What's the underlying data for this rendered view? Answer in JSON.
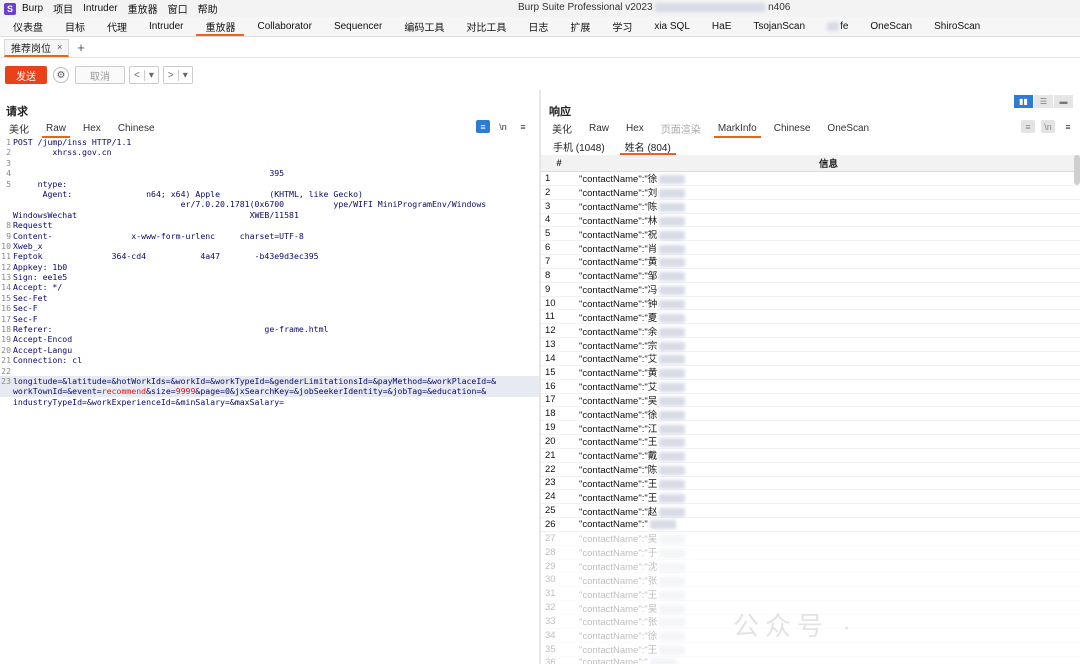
{
  "titlebar": {
    "menus": [
      "Burp",
      "项目",
      "Intruder",
      "重放器",
      "窗口",
      "帮助"
    ],
    "window_title_start": "Burp Suite Professional v2023",
    "window_title_end": "n406"
  },
  "tool_tabs": [
    "仪表盘",
    "目标",
    "代理",
    "Intruder",
    "重放器",
    "Collaborator",
    "Sequencer",
    "编码工具",
    "对比工具",
    "日志",
    "扩展",
    "学习",
    "xia SQL",
    "HaE",
    "TsojanScan",
    "fe",
    "OneScan",
    "ShiroScan"
  ],
  "active_tool_tab": 4,
  "subtab": {
    "label": "推荐岗位",
    "close": "×",
    "add": "+"
  },
  "toolbar": {
    "send": "发送",
    "cancel": "取消",
    "prev": "<",
    "next": ">",
    "dropdown": "▾"
  },
  "request": {
    "title": "请求",
    "tabs": [
      "美化",
      "Raw",
      "Hex",
      "Chinese"
    ],
    "active_tab": 1,
    "icon_newline": "\\n",
    "icon_menu": "≡",
    "lines": [
      {
        "n": "1",
        "t": "POST /jump/inss HTTP/1.1"
      },
      {
        "n": "2",
        "t": "        xhrss.gov.cn"
      },
      {
        "n": "3",
        "t": ""
      },
      {
        "n": "4",
        "t": "                                                    395"
      },
      {
        "n": "5",
        "t": "     ntype:"
      },
      {
        "n": "",
        "t": "      Agent:               n64; x64) Apple          (KHTML, like Gecko)"
      },
      {
        "n": "",
        "t": "                                  er/7.0.20.1781(0x6700          ype/WIFI MiniProgramEnv/Windows"
      },
      {
        "n": "",
        "t": "WindowsWechat                                   XWEB/11581"
      },
      {
        "n": "8",
        "t": "Requestt"
      },
      {
        "n": "9",
        "t": "Content-                x-www-form-urlenc     charset=UTF-8"
      },
      {
        "n": "10",
        "t": "Xweb_x"
      },
      {
        "n": "11",
        "t": "Feptok              364-cd4           4a47       -b43e9d3ec395"
      },
      {
        "n": "12",
        "t": "Appkey: 1b0"
      },
      {
        "n": "13",
        "t": "Sign: ee1e5"
      },
      {
        "n": "14",
        "t": "Accept: */"
      },
      {
        "n": "15",
        "t": "Sec-Fet"
      },
      {
        "n": "16",
        "t": "Sec-F"
      },
      {
        "n": "17",
        "t": "Sec-F"
      },
      {
        "n": "18",
        "t": "Referer:                                           ge-frame.html"
      },
      {
        "n": "19",
        "t": "Accept-Encod"
      },
      {
        "n": "20",
        "t": "Accept-Langu"
      },
      {
        "n": "21",
        "t": "Connection: cl"
      },
      {
        "n": "22",
        "t": ""
      }
    ],
    "body_line1": "longitude=&latitude=&hotWorkIds=&workId=&workTypeId=&genderLimitationsId=&payMethod=&workPlaceId=&",
    "body_line2_pre": "workTownId=&event=",
    "body_line2_red1": "recommend",
    "body_line2_mid": "&size=",
    "body_line2_red2": "9999",
    "body_line2_post": "&page=0&jxSearchKey=&jobSeekerIdentity=&jobTag=&education=&",
    "body_line3": "industryTypeId=&workExperienceId=&minSalary=&maxSalary=",
    "body_line_number": "23"
  },
  "response": {
    "title": "响应",
    "tabs": [
      "美化",
      "Raw",
      "Hex",
      "页面渲染",
      "MarkInfo",
      "Chinese",
      "OneScan"
    ],
    "active_tab": 4,
    "info_tabs": [
      "手机 (1048)",
      "姓名 (804)"
    ],
    "active_info_tab": 1,
    "table_headers": [
      "#",
      "信息"
    ],
    "rows": [
      {
        "n": "1",
        "v": "\"contactName\":\"徐"
      },
      {
        "n": "2",
        "v": "\"contactName\":\"刘"
      },
      {
        "n": "3",
        "v": "\"contactName\":\"陈"
      },
      {
        "n": "4",
        "v": "\"contactName\":\"林"
      },
      {
        "n": "5",
        "v": "\"contactName\":\"祝"
      },
      {
        "n": "6",
        "v": "\"contactName\":\"肖"
      },
      {
        "n": "7",
        "v": "\"contactName\":\"黄"
      },
      {
        "n": "8",
        "v": "\"contactName\":\"邹"
      },
      {
        "n": "9",
        "v": "\"contactName\":\"冯"
      },
      {
        "n": "10",
        "v": "\"contactName\":\"钟"
      },
      {
        "n": "11",
        "v": "\"contactName\":\"夏"
      },
      {
        "n": "12",
        "v": "\"contactName\":\"余"
      },
      {
        "n": "13",
        "v": "\"contactName\":\"宗"
      },
      {
        "n": "14",
        "v": "\"contactName\":\"艾"
      },
      {
        "n": "15",
        "v": "\"contactName\":\"黄"
      },
      {
        "n": "16",
        "v": "\"contactName\":\"艾"
      },
      {
        "n": "17",
        "v": "\"contactName\":\"吴"
      },
      {
        "n": "18",
        "v": "\"contactName\":\"徐"
      },
      {
        "n": "19",
        "v": "\"contactName\":\"江"
      },
      {
        "n": "20",
        "v": "\"contactName\":\"王"
      },
      {
        "n": "21",
        "v": "\"contactName\":\"戴"
      },
      {
        "n": "22",
        "v": "\"contactName\":\"陈"
      },
      {
        "n": "23",
        "v": "\"contactName\":\"王"
      },
      {
        "n": "24",
        "v": "\"contactName\":\"王"
      },
      {
        "n": "25",
        "v": "\"contactName\":\"赵"
      },
      {
        "n": "26",
        "v": "\"contactName\":\""
      },
      {
        "n": "27",
        "v": "\"contactName\":\"吴"
      },
      {
        "n": "28",
        "v": "\"contactName\":\"于"
      },
      {
        "n": "29",
        "v": "\"contactName\":\"沈"
      },
      {
        "n": "30",
        "v": "\"contactName\":\"张"
      },
      {
        "n": "31",
        "v": "\"contactName\":\"王"
      },
      {
        "n": "32",
        "v": "\"contactName\":\"吴"
      },
      {
        "n": "33",
        "v": "\"contactName\":\"张"
      },
      {
        "n": "34",
        "v": "\"contactName\":\"徐"
      },
      {
        "n": "35",
        "v": "\"contactName\":\"王"
      },
      {
        "n": "36",
        "v": "\"contactName\":\""
      }
    ]
  },
  "watermark": "公众号 · "
}
